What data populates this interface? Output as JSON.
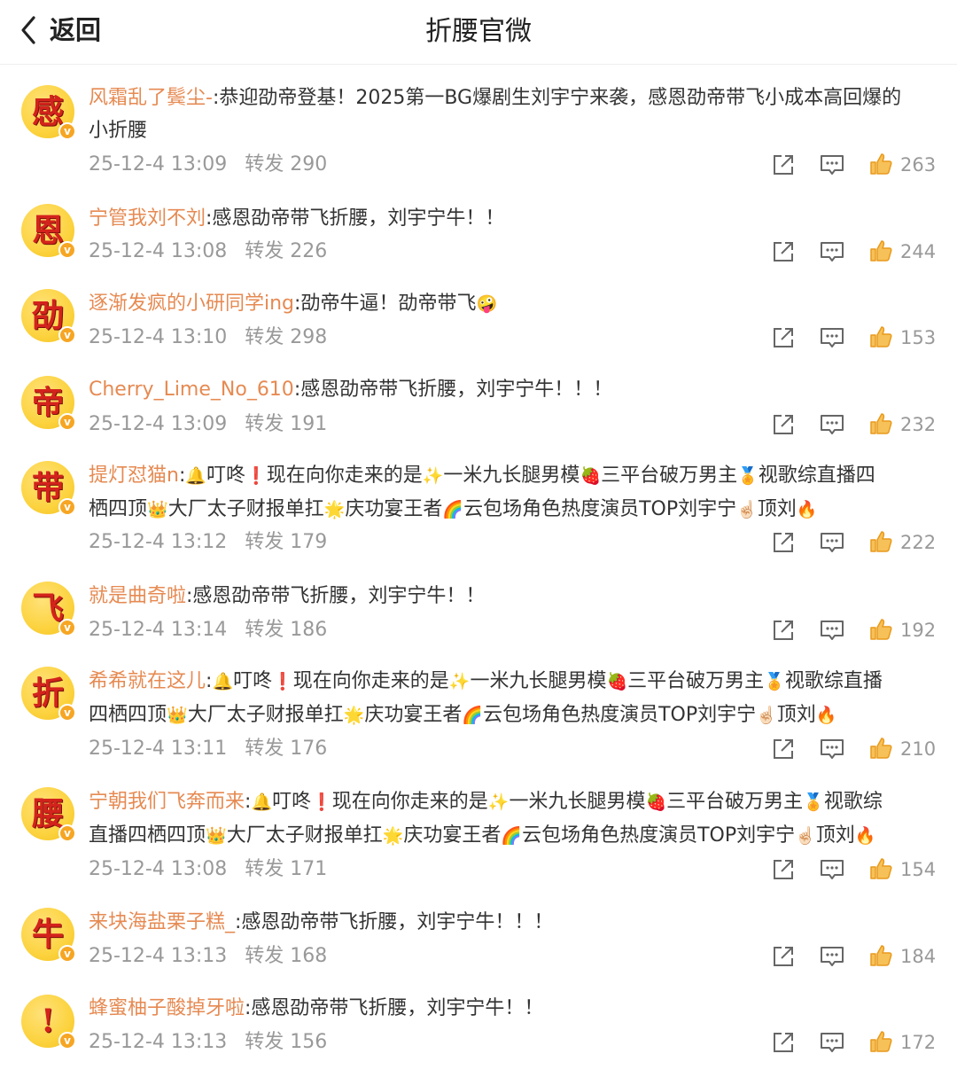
{
  "header": {
    "back_label": "返回",
    "title": "折腰官微"
  },
  "comments": [
    {
      "avatar_char": "感",
      "username": "风霜乱了鬓尘-",
      "segments": [
        ":恭迎劭帝登基！2025第一BG爆剧生刘宇宁来袭，感恩劭帝带飞小成本高回爆的",
        "小折腰"
      ],
      "time": "25-12-4 13:09",
      "forward_label": "转发",
      "forwards": "290",
      "likes": "263"
    },
    {
      "avatar_char": "恩",
      "username": "宁管我刘不刘",
      "segments": [
        ":感恩劭帝带飞折腰，刘宇宁牛！！"
      ],
      "time": "25-12-4 13:08",
      "forward_label": "转发",
      "forwards": "226",
      "likes": "244"
    },
    {
      "avatar_char": "劭",
      "username": "逐渐发疯的小研同学ing",
      "segments": [
        ":劭帝牛逼！劭帝带飞",
        "🤪"
      ],
      "time": "25-12-4 13:10",
      "forward_label": "转发",
      "forwards": "298",
      "likes": "153"
    },
    {
      "avatar_char": "帝",
      "username": "Cherry_Lime_No_610",
      "segments": [
        ":感恩劭帝带飞折腰，刘宇宁牛！！！"
      ],
      "time": "25-12-4 13:09",
      "forward_label": "转发",
      "forwards": "191",
      "likes": "232"
    },
    {
      "avatar_char": "带",
      "username": "提灯怼猫n",
      "segments": [
        ":",
        "🔔",
        "叮咚",
        "❗",
        "现在向你走来的是",
        "✨",
        "一米九长腿男模",
        "🍓",
        "三平台破万男主",
        "🏅",
        "视歌综直播四",
        "栖四顶",
        "👑",
        "大厂太子财报单扛",
        "🌟",
        "庆功宴王者",
        "🌈",
        "云包场角色热度演员TOP刘宇宁",
        "☝🏻",
        "顶刘",
        "🔥"
      ],
      "time": "25-12-4 13:12",
      "forward_label": "转发",
      "forwards": "179",
      "likes": "222"
    },
    {
      "avatar_char": "飞",
      "username": "就是曲奇啦",
      "segments": [
        ":感恩劭帝带飞折腰，刘宇宁牛！！"
      ],
      "time": "25-12-4 13:14",
      "forward_label": "转发",
      "forwards": "186",
      "likes": "192"
    },
    {
      "avatar_char": "折",
      "username": "希希就在这儿",
      "segments": [
        ":",
        "🔔",
        "叮咚",
        "❗",
        "现在向你走来的是",
        "✨",
        "一米九长腿男模",
        "🍓",
        "三平台破万男主",
        "🏅",
        "视歌综直播",
        "四栖四顶",
        "👑",
        "大厂太子财报单扛",
        "🌟",
        "庆功宴王者",
        "🌈",
        "云包场角色热度演员TOP刘宇宁",
        "☝🏻",
        "顶刘",
        "🔥"
      ],
      "time": "25-12-4 13:11",
      "forward_label": "转发",
      "forwards": "176",
      "likes": "210"
    },
    {
      "avatar_char": "腰",
      "username": "宁朝我们飞奔而来",
      "segments": [
        ":",
        "🔔",
        "叮咚",
        "❗",
        "现在向你走来的是",
        "✨",
        "一米九长腿男模",
        "🍓",
        "三平台破万男主",
        "🏅",
        "视歌综",
        "直播四栖四顶",
        "👑",
        "大厂太子财报单扛",
        "🌟",
        "庆功宴王者",
        "🌈",
        "云包场角色热度演员TOP刘宇宁",
        "☝🏻",
        "顶刘",
        "🔥"
      ],
      "time": "25-12-4 13:08",
      "forward_label": "转发",
      "forwards": "171",
      "likes": "154"
    },
    {
      "avatar_char": "牛",
      "username": "来块海盐栗子糕_",
      "segments": [
        ":感恩劭帝带飞折腰，刘宇宁牛！！！"
      ],
      "time": "25-12-4 13:13",
      "forward_label": "转发",
      "forwards": "168",
      "likes": "184"
    },
    {
      "avatar_char": "!",
      "username": "蜂蜜柚子酸掉牙啦",
      "segments": [
        ":感恩劭帝带飞折腰，刘宇宁牛！！"
      ],
      "time": "25-12-4 13:13",
      "forward_label": "转发",
      "forwards": "156",
      "likes": "172"
    }
  ],
  "icons": {
    "back": "chevron-left-icon",
    "share": "share-icon",
    "comment": "comment-icon",
    "like": "thumbs-up-icon",
    "verified": "verified-badge-icon"
  },
  "colors": {
    "username": "#e68a52",
    "like": "#f0a020",
    "meta": "#999999",
    "avatar_bg": "#fcd33f",
    "avatar_char": "#d3231c"
  }
}
